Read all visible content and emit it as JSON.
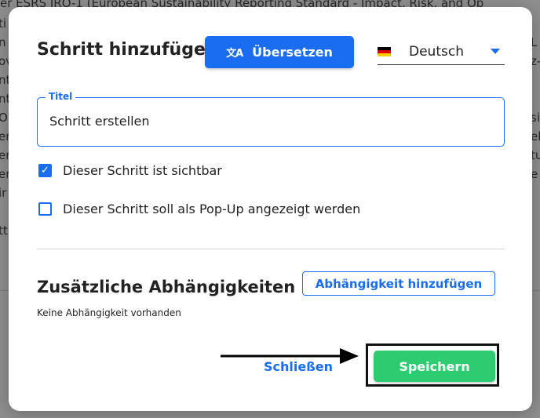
{
  "background": {
    "top_text": "er ESRS IRO-1 (European Sustainability Reporting Standard - Impact, Risk, and Op",
    "left_fragments": [
      "ti",
      "n",
      "ov",
      "nt",
      "nt",
      "O",
      "er",
      "er",
      "er",
      "ir",
      "",
      "tt"
    ],
    "right_fragments": [
      "L",
      "z-",
      "",
      "",
      "si",
      "el",
      "tu",
      "e",
      ""
    ]
  },
  "dialog": {
    "title": "Schritt hinzufügen",
    "translate_button": {
      "label": "Übersetzen",
      "icon": "translate-icon",
      "icon_glyph": "文A"
    },
    "language": {
      "selected": "Deutsch",
      "flag_colors": [
        "#000000",
        "#dd0000",
        "#ffce00"
      ]
    },
    "title_field": {
      "legend": "Titel",
      "value": "Schritt erstellen"
    },
    "checkboxes": [
      {
        "label": "Dieser Schritt ist sichtbar",
        "checked": true
      },
      {
        "label": "Dieser Schritt soll als Pop-Up angezeigt werden",
        "checked": false
      }
    ],
    "dependencies": {
      "title": "Zusätzliche Abhängigkeiten",
      "add_button": "Abhängigkeit hinzufügen",
      "empty_text": "Keine Abhängigkeit vorhanden"
    },
    "footer": {
      "close_label": "Schließen",
      "save_label": "Speichern"
    }
  },
  "colors": {
    "accent": "#1a6df0",
    "save": "#2ecc71"
  }
}
